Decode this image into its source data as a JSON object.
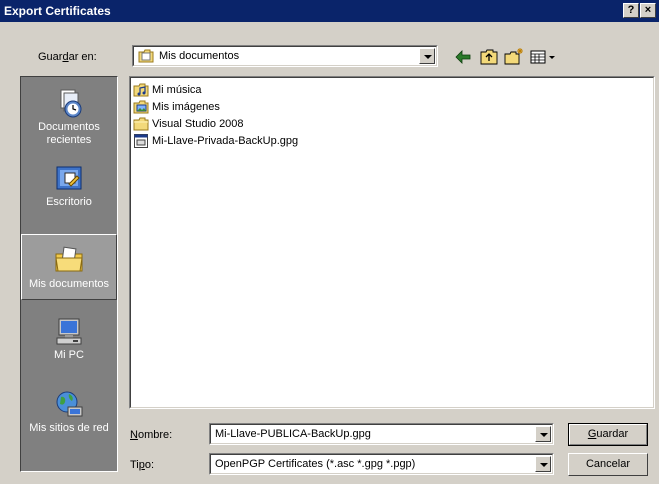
{
  "window": {
    "title": "Export Certificates"
  },
  "titlebar_buttons": {
    "help": "?",
    "close": "×"
  },
  "location": {
    "label_pre": "Guar",
    "label_accel": "d",
    "label_post": "ar en:",
    "value": "Mis documentos"
  },
  "toolbar": {
    "back": "back-arrow-icon",
    "up": "up-folder-icon",
    "new_folder": "new-folder-icon",
    "views": "view-menu-icon"
  },
  "places": [
    {
      "label": "Documentos recientes",
      "icon": "recent-documents-icon"
    },
    {
      "label": "Escritorio",
      "icon": "desktop-icon"
    },
    {
      "label": "Mis documentos",
      "icon": "my-documents-icon",
      "selected": true
    },
    {
      "label": "Mi PC",
      "icon": "my-computer-icon"
    },
    {
      "label": "Mis sitios de red",
      "icon": "network-places-icon"
    }
  ],
  "files": [
    {
      "name": "Mi música",
      "icon": "music-folder-icon"
    },
    {
      "name": "Mis imágenes",
      "icon": "pictures-folder-icon"
    },
    {
      "name": "Visual Studio 2008",
      "icon": "folder-icon"
    },
    {
      "name": "Mi-Llave-Privada-BackUp.gpg",
      "icon": "gpg-file-icon"
    }
  ],
  "filename": {
    "label_accel": "N",
    "label_post": "ombre:",
    "value": "Mi-Llave-PUBLICA-BackUp.gpg"
  },
  "filetype": {
    "label_pre": "Ti",
    "label_accel": "p",
    "label_post": "o:",
    "value": "OpenPGP Certificates (*.asc *.gpg *.pgp)"
  },
  "buttons": {
    "save_accel": "G",
    "save_post": "uardar",
    "cancel": "Cancelar"
  }
}
